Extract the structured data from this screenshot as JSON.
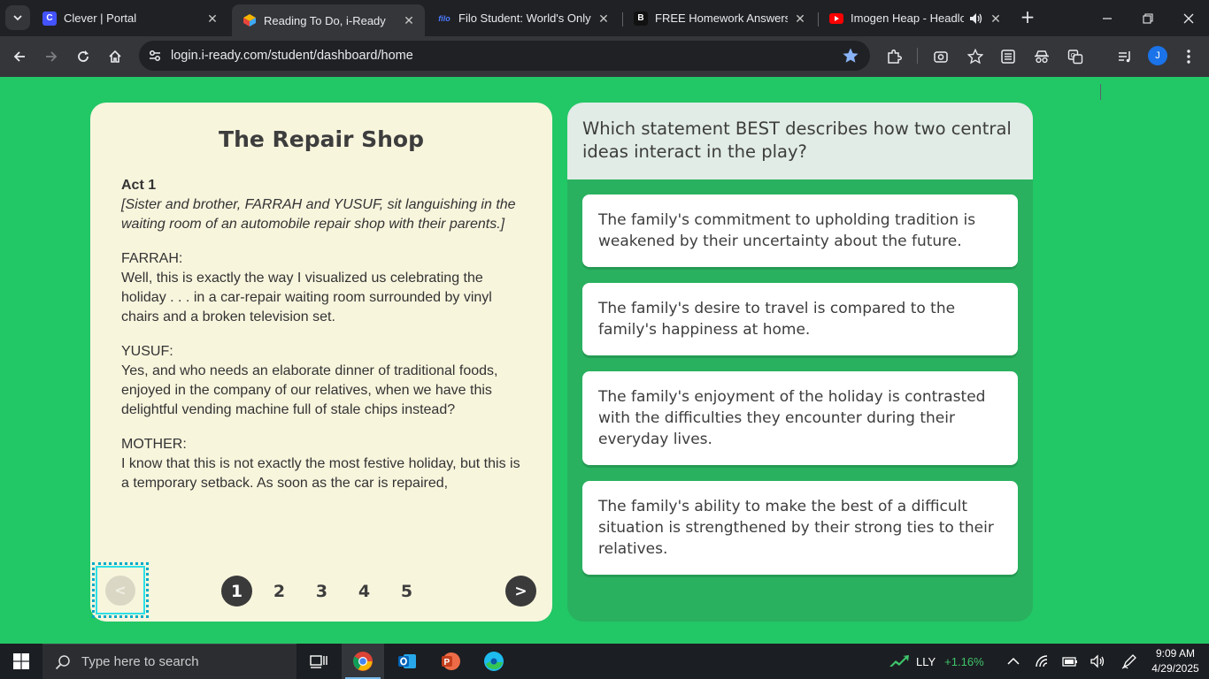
{
  "browser": {
    "tabs": [
      {
        "title": "Clever | Portal",
        "favicon": "C",
        "favicon_color": "#4353ff"
      },
      {
        "title": "Reading To Do, i-Ready",
        "favicon": "",
        "favicon_color": "#e8a33d"
      },
      {
        "title": "Filo Student: World's Only Li",
        "favicon": "filo",
        "favicon_color": "#202124"
      },
      {
        "title": "FREE Homework Answers fro",
        "favicon": "B",
        "favicon_color": "#111111"
      },
      {
        "title": "Imogen Heap - Headlock",
        "favicon": "",
        "favicon_color": "#ff0000"
      }
    ],
    "url": "login.i-ready.com/student/dashboard/home",
    "profile_initial": "J"
  },
  "passage": {
    "title": "The Repair Shop",
    "act": "Act 1",
    "stage_direction": "[Sister and brother, FARRAH and YUSUF, sit languishing in the waiting room of an automobile repair shop with their parents.]",
    "lines": [
      {
        "speaker": "FARRAH:",
        "text": "Well, this is exactly the way I visualized us celebrating the holiday . . . in a car-repair waiting room surrounded by vinyl chairs and a broken television set."
      },
      {
        "speaker": "YUSUF:",
        "text": "Yes, and who needs an elaborate dinner of traditional foods, enjoyed in the company of our relatives, when we have this delightful vending machine full of stale chips instead?"
      },
      {
        "speaker": "MOTHER:",
        "text": "I know that this is not exactly the most festive holiday, but this is a temporary setback. As soon as the car is repaired,"
      }
    ],
    "pager": {
      "prev": "<",
      "next": ">",
      "pages": [
        "1",
        "2",
        "3",
        "4",
        "5"
      ],
      "current": 1
    }
  },
  "question": {
    "text": "Which statement BEST describes how two central ideas interact in the play?",
    "options": [
      "The family's commitment to upholding tradition is weakened by their uncertainty about the future.",
      "The family's desire to travel is compared to the family's happiness at home.",
      "The family's enjoyment of the holiday is contrasted with the difficulties they encounter during their everyday lives.",
      "The family's ability to make the best of a difficult situation is strengthened by their strong ties to their relatives."
    ]
  },
  "taskbar": {
    "search_placeholder": "Type here to search",
    "stock_symbol": "LLY",
    "stock_change": "+1.16%",
    "time": "9:09 AM",
    "date": "4/29/2025"
  },
  "colors": {
    "page_bg": "#22c766",
    "passage_bg": "#f8f5dd",
    "question_panel": "#29b15f",
    "question_header": "#e1ece6",
    "accent_dark": "#3a3a3a"
  }
}
